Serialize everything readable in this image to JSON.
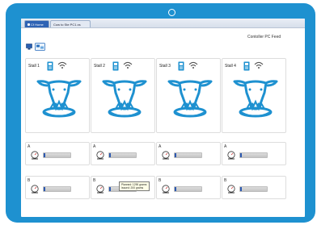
{
  "window": {
    "tabs": [
      {
        "label": "Cf Home"
      },
      {
        "label": "Cow to Ste PC1.xs"
      }
    ]
  },
  "app": {
    "title": "Contoller PC Feed"
  },
  "stalls": [
    {
      "label": "Stall 1",
      "feeders": [
        {
          "label": "A",
          "fill": 0.05
        },
        {
          "label": "B",
          "fill": 0.05
        }
      ]
    },
    {
      "label": "Stall 2",
      "feeders": [
        {
          "label": "A",
          "fill": 0.05
        },
        {
          "label": "B",
          "fill": 0.05
        }
      ]
    },
    {
      "label": "Stall 3",
      "feeders": [
        {
          "label": "A",
          "fill": 0.05
        },
        {
          "label": "B",
          "fill": 0.05
        }
      ]
    },
    {
      "label": "Stall 4",
      "feeders": [
        {
          "label": "A",
          "fill": 0.05
        },
        {
          "label": "B",
          "fill": 0.05
        }
      ]
    }
  ],
  "tooltip": {
    "line1": "Planned: 1290 grams",
    "line2": "Issued: 200 grams"
  },
  "colors": {
    "frame": "#1e91d0",
    "icon_blue": "#1e91d0",
    "bar_fill": "#2b58b0"
  },
  "icons": {
    "feeder": "feeder-unit-icon",
    "signal": "wifi-icon",
    "cow": "cow-feeding-icon",
    "scale": "scale-gauge-icon"
  }
}
